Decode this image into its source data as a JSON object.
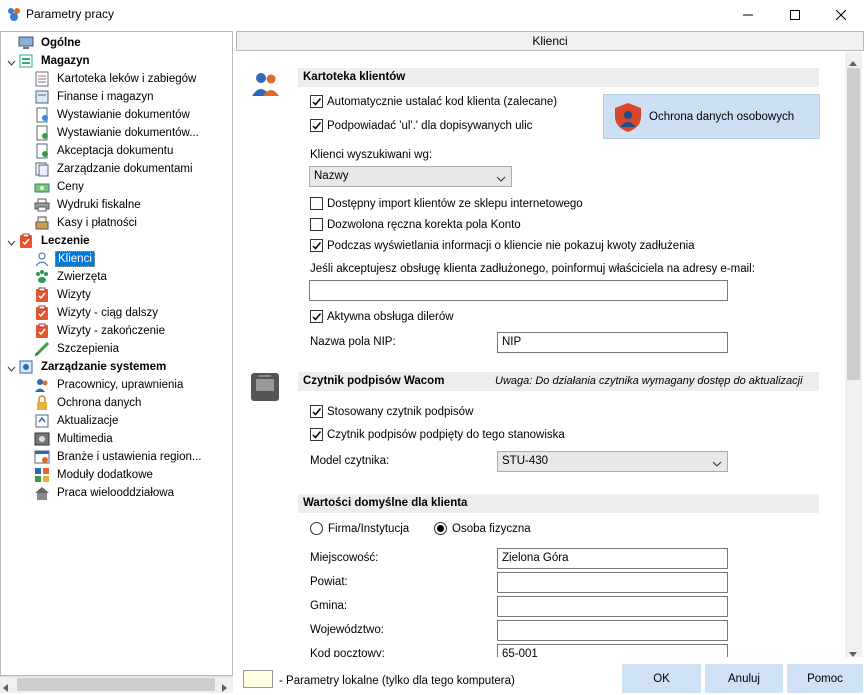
{
  "window": {
    "title": "Parametry pracy",
    "controls": [
      "minimize",
      "maximize",
      "close"
    ]
  },
  "tree": {
    "groups": [
      {
        "label": "Ogólne",
        "icon": "computer-icon",
        "expandable": false
      },
      {
        "label": "Magazyn",
        "icon": "warehouse-icon",
        "expandable": true,
        "items": [
          {
            "label": "Kartoteka leków i zabiegów",
            "icon": "drug-list-icon"
          },
          {
            "label": "Finanse i magazyn",
            "icon": "finance-icon"
          },
          {
            "label": "Wystawianie dokumentów",
            "icon": "document-icon"
          },
          {
            "label": "Wystawianie dokumentów...",
            "icon": "document-add-icon"
          },
          {
            "label": "Akceptacja dokumentu",
            "icon": "document-accept-icon"
          },
          {
            "label": "Zarządzanie dokumentami",
            "icon": "documents-manage-icon"
          },
          {
            "label": "Ceny",
            "icon": "money-icon"
          },
          {
            "label": "Wydruki fiskalne",
            "icon": "printer-icon"
          },
          {
            "label": "Kasy i płatności",
            "icon": "cash-register-icon"
          }
        ]
      },
      {
        "label": "Leczenie",
        "icon": "clipboard-check-icon",
        "expandable": true,
        "items": [
          {
            "label": "Klienci",
            "icon": "user-icon",
            "selected": true
          },
          {
            "label": "Zwierzęta",
            "icon": "paw-icon"
          },
          {
            "label": "Wizyty",
            "icon": "clipboard-check-icon"
          },
          {
            "label": "Wizyty - ciąg dalszy",
            "icon": "clipboard-check-icon"
          },
          {
            "label": "Wizyty - zakończenie",
            "icon": "clipboard-check-icon"
          },
          {
            "label": "Szczepienia",
            "icon": "syringe-icon"
          }
        ]
      },
      {
        "label": "Zarządzanie systemem",
        "icon": "system-icon",
        "expandable": true,
        "items": [
          {
            "label": "Pracownicy, uprawnienia",
            "icon": "users-icon"
          },
          {
            "label": "Ochrona danych",
            "icon": "lock-icon"
          },
          {
            "label": "Aktualizacje",
            "icon": "update-icon"
          },
          {
            "label": "Multimedia",
            "icon": "multimedia-icon"
          },
          {
            "label": "Branże i ustawienia region...",
            "icon": "region-icon"
          },
          {
            "label": "Moduły dodatkowe",
            "icon": "modules-icon"
          },
          {
            "label": "Praca wielooddziałowa",
            "icon": "home-icon"
          }
        ]
      }
    ]
  },
  "panel": {
    "header": "Klienci",
    "kartoteka": {
      "title": "Kartoteka klientów",
      "cb_auto_code": {
        "label": "Automatycznie ustalać kod klienta (zalecane)",
        "checked": true
      },
      "cb_street": {
        "label": "Podpowiadać 'ul'.' dla dopisywanych ulic",
        "checked": true
      },
      "ochrona_button": "Ochrona danych osobowych",
      "search_label": "Klienci wyszukiwani wg:",
      "search_value": "Nazwy",
      "cb_import": {
        "label": "Dostępny import klientów ze sklepu internetowego",
        "checked": false
      },
      "cb_konto": {
        "label": "Dozwolona ręczna korekta pola Konto",
        "checked": false
      },
      "cb_debt": {
        "label": "Podczas wyświetlania informacji o kliencie nie pokazuj kwoty zadłużenia",
        "checked": true
      },
      "email_label": "Jeśli akceptujesz obsługę klienta zadłużonego, poinformuj właściciela na adresy e-mail:",
      "email_value": "",
      "cb_dealers": {
        "label": "Aktywna obsługa dilerów",
        "checked": true
      },
      "nip_label": "Nazwa pola NIP:",
      "nip_value": "NIP"
    },
    "wacom": {
      "title": "Czytnik podpisów Wacom",
      "note": "Uwaga: Do działania czytnika wymagany dostęp do aktualizacji",
      "cb_used": {
        "label": "Stosowany czytnik podpisów",
        "checked": true
      },
      "cb_connected": {
        "label": "Czytnik podpisów podpięty do tego stanowiska",
        "checked": true
      },
      "model_label": "Model czytnika:",
      "model_value": "STU-430"
    },
    "defaults": {
      "title": "Wartości domyślne dla klienta",
      "radio_firm": {
        "label": "Firma/Instytucja",
        "selected": false
      },
      "radio_person": {
        "label": "Osoba fizyczna",
        "selected": true
      },
      "fields": [
        {
          "label": "Miejscowość:",
          "value": "Zielona Góra"
        },
        {
          "label": "Powiat:",
          "value": ""
        },
        {
          "label": "Gmina:",
          "value": ""
        },
        {
          "label": "Województwo:",
          "value": ""
        },
        {
          "label": "Kod pocztowy:",
          "value": "65-001"
        }
      ]
    }
  },
  "footer": {
    "legend": "- Parametry lokalne (tylko dla tego komputera)",
    "legend_color": "#ffffe1",
    "ok": "OK",
    "cancel": "Anuluj",
    "help": "Pomoc"
  },
  "colors": {
    "selection": "#0078d7",
    "button_bg": "#cfe1f4",
    "section_bg": "#ededed"
  }
}
